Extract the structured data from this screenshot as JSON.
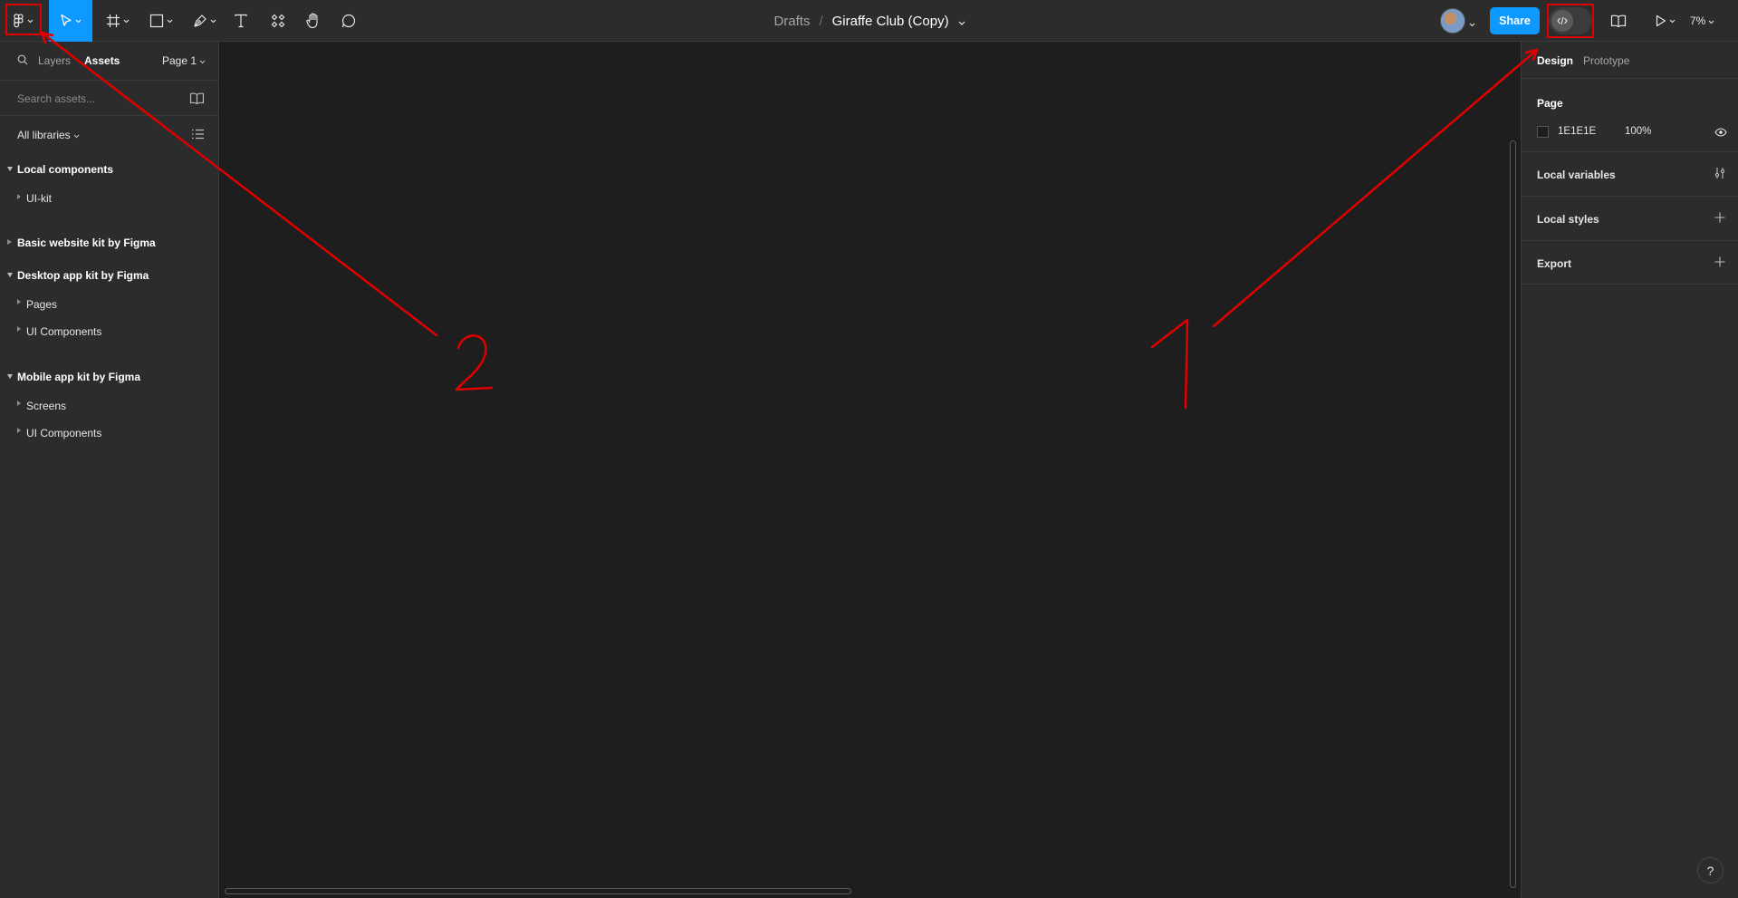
{
  "toolbar": {
    "breadcrumb_root": "Drafts",
    "breadcrumb_sep": "/",
    "file_name": "Giraffe Club (Copy)",
    "share_label": "Share",
    "zoom": "7%",
    "icons": [
      "figma-menu-icon",
      "move-tool-icon",
      "frame-tool-icon",
      "shape-tool-icon",
      "pen-tool-icon",
      "text-tool-icon",
      "resources-icon",
      "hand-tool-icon",
      "comment-icon",
      "dev-mode-icon",
      "library-icon",
      "present-icon"
    ]
  },
  "left_panel": {
    "tabs": {
      "layers": "Layers",
      "assets": "Assets"
    },
    "page_selector": "Page 1",
    "search_placeholder": "Search assets...",
    "libraries_filter": "All libraries",
    "groups": [
      {
        "title": "Local components",
        "expanded": true,
        "items": [
          "UI-kit"
        ]
      },
      {
        "title": "Basic website kit by Figma",
        "expanded": false,
        "items": []
      },
      {
        "title": "Desktop app kit by Figma",
        "expanded": true,
        "items": [
          "Pages",
          "UI Components"
        ]
      },
      {
        "title": "Mobile app kit by Figma",
        "expanded": true,
        "items": [
          "Screens",
          "UI Components"
        ]
      }
    ]
  },
  "right_panel": {
    "tabs": {
      "design": "Design",
      "prototype": "Prototype"
    },
    "page_section": {
      "title": "Page",
      "color_hex": "1E1E1E",
      "opacity": "100%"
    },
    "local_variables": "Local variables",
    "local_styles": "Local styles",
    "export": "Export"
  },
  "help_label": "?",
  "annotations": {
    "color": "#e00000",
    "labels": [
      "1",
      "2"
    ]
  },
  "colors": {
    "accent": "#0d99ff",
    "panel_bg": "#2c2c2c",
    "canvas_bg": "#1e1e1e"
  }
}
